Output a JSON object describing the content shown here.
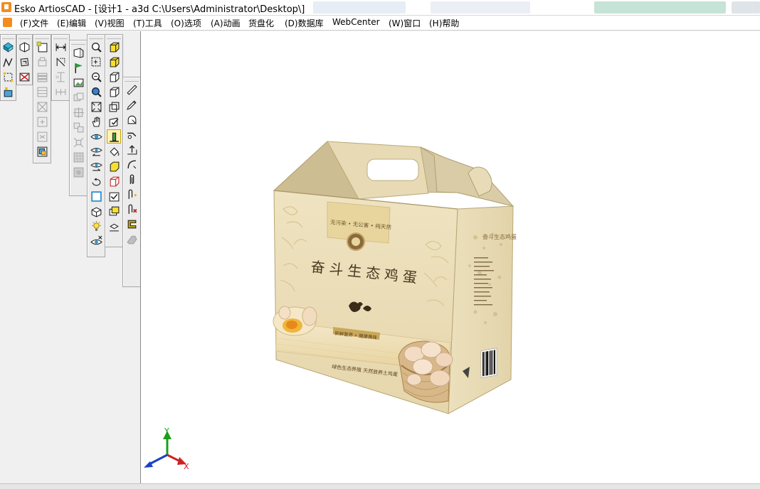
{
  "window": {
    "title": "Esko ArtiosCAD - [设计1 - a3d C:\\Users\\Administrator\\Desktop\\]"
  },
  "menu": [
    {
      "key": "(F)",
      "label": "文件"
    },
    {
      "key": "(E)",
      "label": "编辑"
    },
    {
      "key": "(V)",
      "label": "视图"
    },
    {
      "key": "(T)",
      "label": "工具"
    },
    {
      "key": "(O)",
      "label": "选项"
    },
    {
      "key": "(A)",
      "label": "动画"
    },
    {
      "key": "",
      "label": "货盘化"
    },
    {
      "key": "(D)",
      "label": "数据库"
    },
    {
      "key": "",
      "label": "WebCenter"
    },
    {
      "key": "(W)",
      "label": "窗口"
    },
    {
      "key": "(H)",
      "label": "帮助"
    }
  ],
  "box": {
    "product_title": "奋斗生态鸡蛋",
    "badge_text": "无污染 • 无公害 • 纯天然",
    "ribbon_text": "新鲜营养 • 健康美味",
    "bottom_text": "绿色生态养殖  天然放养土鸡蛋",
    "side_text": "奋斗生态鸡蛋",
    "colors": {
      "cream": "#f1e6c6",
      "tan": "#e2cf9e",
      "top_flap": "#d6c9a4",
      "side": "#e9ddb9",
      "gold": "#c9a85a"
    }
  },
  "axes": {
    "x_label": "X",
    "y_label": "Y"
  }
}
